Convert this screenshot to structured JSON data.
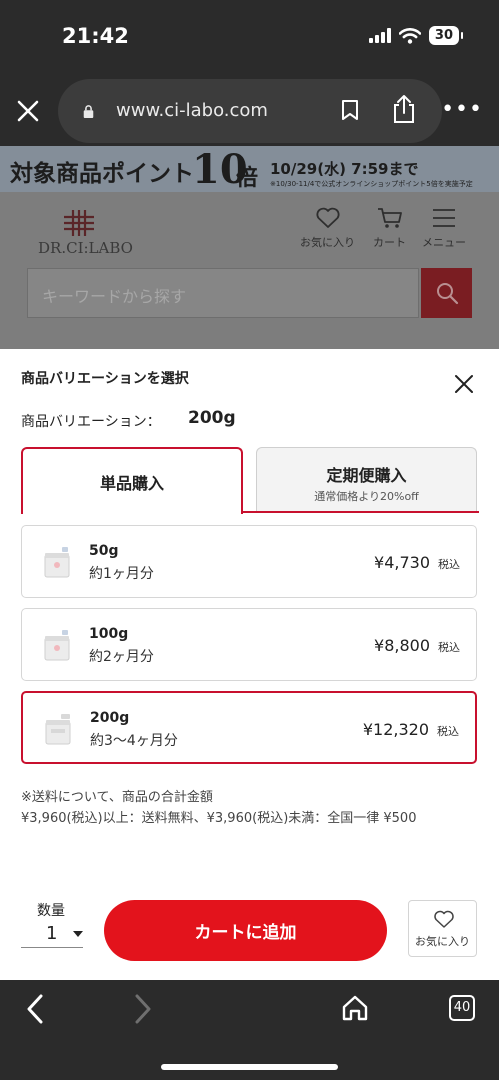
{
  "status": {
    "time": "21:42",
    "battery": "30"
  },
  "browser": {
    "url": "www.ci-labo.com"
  },
  "site": {
    "promo": {
      "main": "対象商品ポイント",
      "big": "10",
      "bai": "倍",
      "date": "10/29(水) 7:59まで",
      "note": "※10/30-11/4で公式オンラインショップポイント5倍を実施予定"
    },
    "logo": "DR.CI:LABO",
    "nav": {
      "favorite": "お気に入り",
      "cart": "カート",
      "menu": "メニュー"
    },
    "search_placeholder": "キーワードから探す"
  },
  "sheet": {
    "title": "商品バリエーションを選択",
    "variation_label": "商品バリエーション：",
    "variation_value": "200g",
    "tabs": {
      "single": "単品購入",
      "subscription": "定期便購入",
      "subscription_note": "通常価格より20%off"
    },
    "options": [
      {
        "size": "50g",
        "term": "約1ヶ月分",
        "price": "¥4,730",
        "tax": "税込"
      },
      {
        "size": "100g",
        "term": "約2ヶ月分",
        "price": "¥8,800",
        "tax": "税込"
      },
      {
        "size": "200g",
        "term": "約3〜4ヶ月分",
        "price": "¥12,320",
        "tax": "税込"
      }
    ],
    "shipping_line1": "※送料について、商品の合計金額",
    "shipping_line2": "¥3,960(税込)以上：送料無料、¥3,960(税込)未満：全国一律 ¥500",
    "quantity_label": "数量",
    "quantity_value": "1",
    "add_to_cart": "カートに追加",
    "favorite": "お気に入り"
  },
  "toolbar": {
    "tab_count": "40"
  },
  "colors": {
    "accent": "#e3131c",
    "border_red": "#c8102e"
  }
}
